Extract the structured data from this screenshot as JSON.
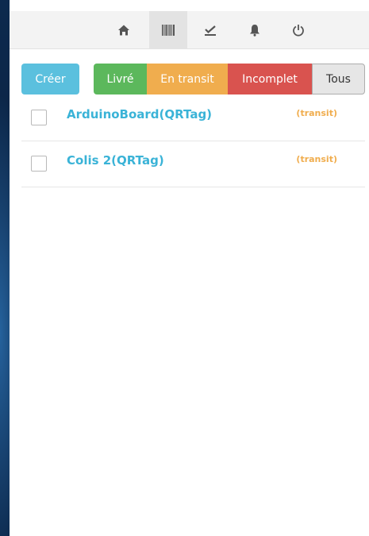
{
  "nav": {
    "items": [
      {
        "icon": "home-icon",
        "active": false
      },
      {
        "icon": "barcode-icon",
        "active": true
      },
      {
        "icon": "checkmark-icon",
        "active": false
      },
      {
        "icon": "bell-icon",
        "active": false
      },
      {
        "icon": "power-icon",
        "active": false
      }
    ]
  },
  "toolbar": {
    "create_label": "Créer",
    "filters": {
      "delivered": "Livré",
      "in_transit": "En transit",
      "incomplete": "Incomplet",
      "all": "Tous"
    },
    "active_filter": "all"
  },
  "items": [
    {
      "name": "ArduinoBoard(QRTag)",
      "status": "(transit)",
      "checked": false
    },
    {
      "name": "Colis 2(QRTag)",
      "status": "(transit)",
      "checked": false
    }
  ],
  "colors": {
    "create": "#5bc0de",
    "delivered": "#5cb85c",
    "in_transit": "#f0ad4e",
    "incomplete": "#d9534f",
    "all": "#e6e6e6",
    "item_link": "#3ab3d7",
    "status_text": "#f0ad4e"
  }
}
